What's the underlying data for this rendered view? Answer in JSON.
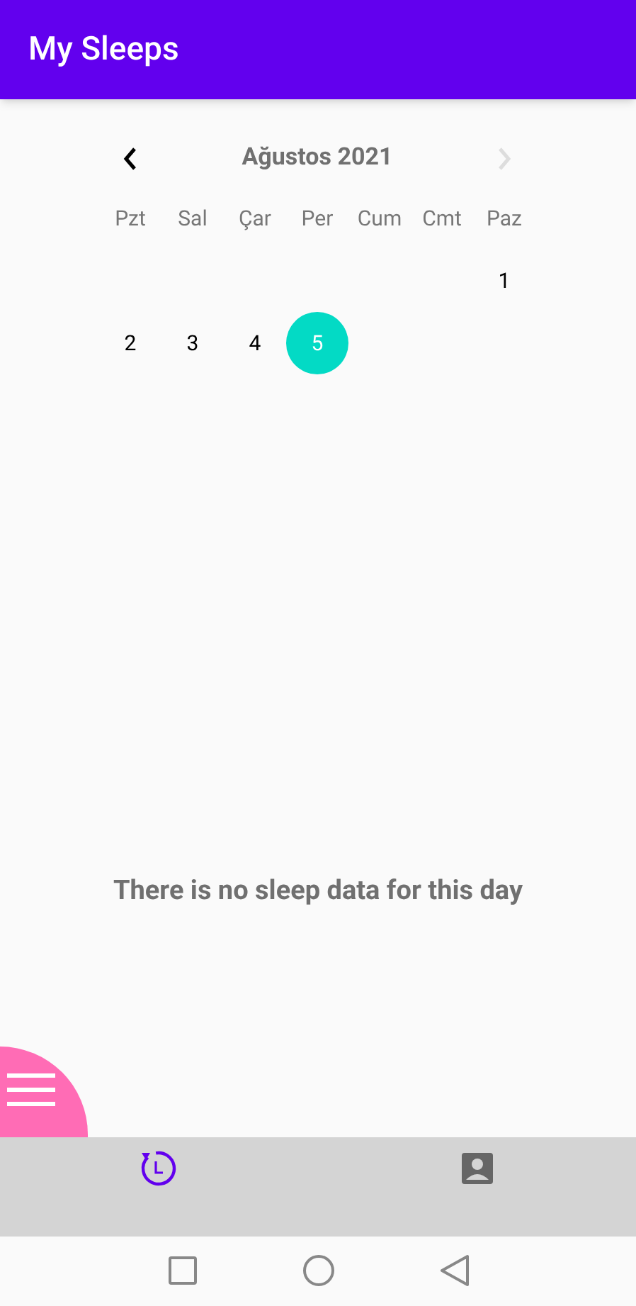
{
  "app_bar": {
    "title": "My Sleeps"
  },
  "calendar": {
    "month": "Ağustos 2021",
    "prev_enabled": true,
    "next_enabled": false,
    "weekdays": [
      "Pzt",
      "Sal",
      "Çar",
      "Per",
      "Cum",
      "Cmt",
      "Paz"
    ],
    "weeks": [
      {
        "kind": "trailing",
        "days": [
          {
            "day": "1",
            "selected": false
          }
        ]
      },
      {
        "kind": "leading",
        "days": [
          {
            "day": "2",
            "selected": false
          },
          {
            "day": "3",
            "selected": false
          },
          {
            "day": "4",
            "selected": false
          },
          {
            "day": "5",
            "selected": true
          }
        ]
      }
    ]
  },
  "message": "There is no sleep data for this day",
  "bottom_nav": [
    {
      "kind": "history",
      "selected": true
    },
    {
      "kind": "profile",
      "selected": false
    }
  ]
}
